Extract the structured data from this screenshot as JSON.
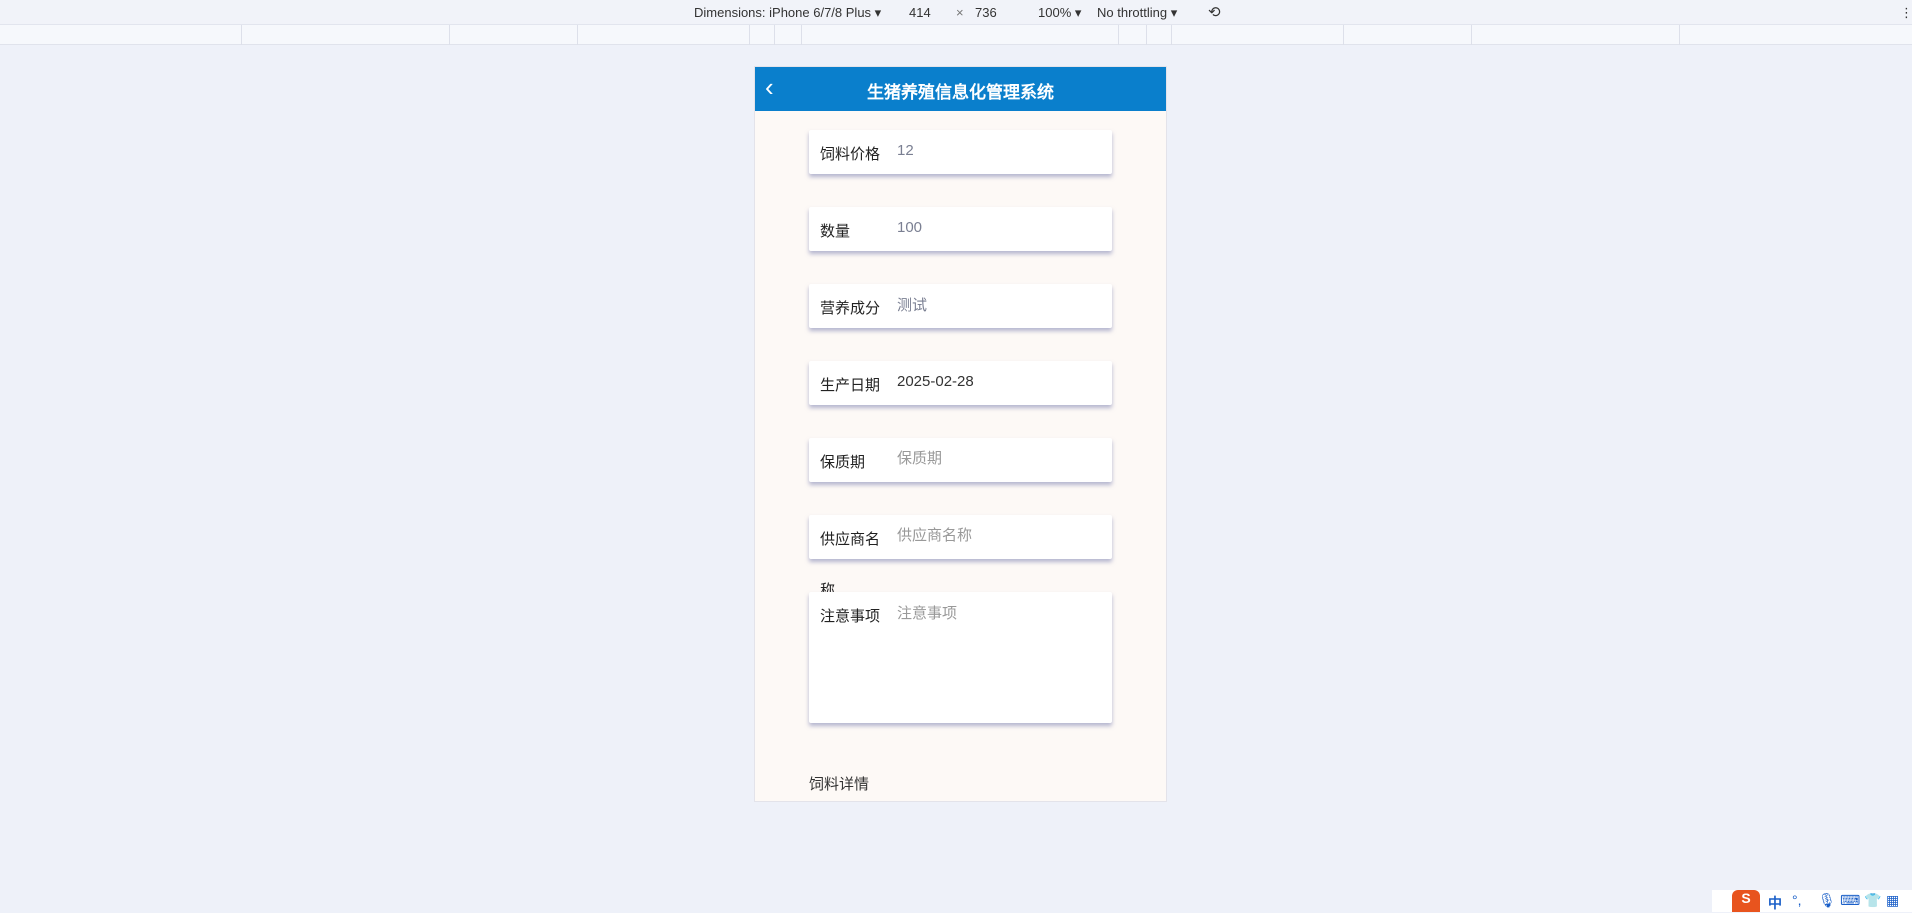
{
  "devtools": {
    "dimensions": "Dimensions: iPhone 6/7/8 Plus ▾",
    "width": "414",
    "times": "×",
    "height": "736",
    "zoom": "100% ▾",
    "throttling": "No throttling ▾",
    "more": "⋮"
  },
  "header": {
    "title": "生猪养殖信息化管理系统",
    "back": "‹"
  },
  "form": {
    "fields": [
      {
        "label": "饲料价格",
        "value": "12",
        "placeholder": ""
      },
      {
        "label": "数量",
        "value": "100",
        "placeholder": ""
      },
      {
        "label": "营养成分",
        "value": "测试",
        "placeholder": ""
      },
      {
        "label": "生产日期",
        "value": "2025-02-28",
        "placeholder": ""
      },
      {
        "label": "保质期",
        "value": "",
        "placeholder": "保质期"
      },
      {
        "label": "供应商名",
        "value": "",
        "placeholder": "供应商名称"
      }
    ],
    "label_overflow": "称",
    "notes": {
      "label": "注意事项",
      "placeholder": "注意事项"
    }
  },
  "section": {
    "detail": "饲料详情"
  },
  "tray": {
    "ime": "S",
    "lang": "中",
    "punct": "°,"
  }
}
